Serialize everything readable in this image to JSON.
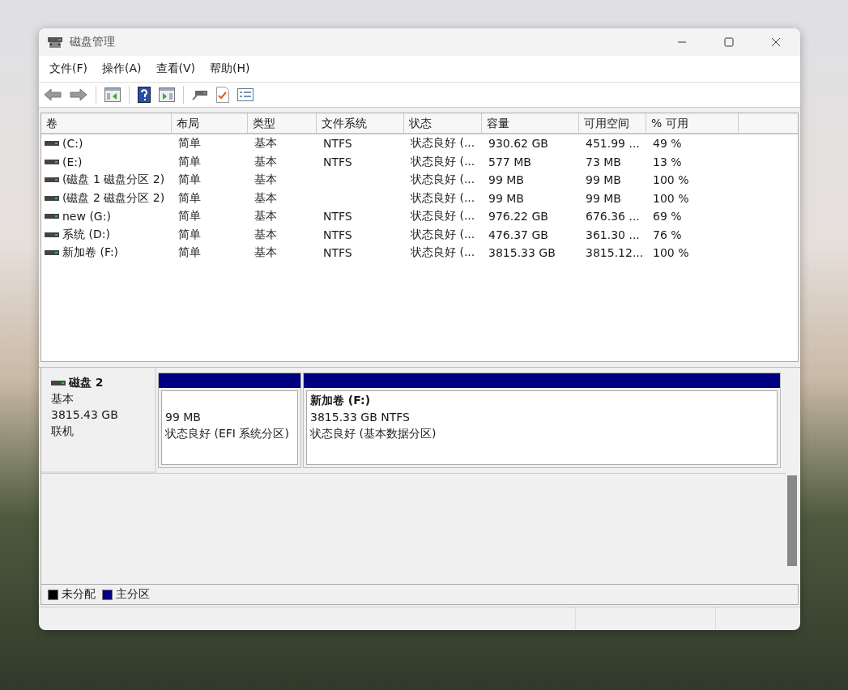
{
  "window": {
    "title": "磁盘管理"
  },
  "menu": [
    "文件(F)",
    "操作(A)",
    "查看(V)",
    "帮助(H)"
  ],
  "volume_table": {
    "columns": [
      "卷",
      "布局",
      "类型",
      "文件系统",
      "状态",
      "容量",
      "可用空间",
      "% 可用"
    ],
    "rows": [
      [
        "(C:)",
        "简单",
        "基本",
        "NTFS",
        "状态良好 (...",
        "930.62 GB",
        "451.99 ...",
        "49 %"
      ],
      [
        "(E:)",
        "简单",
        "基本",
        "NTFS",
        "状态良好 (...",
        "577 MB",
        "73 MB",
        "13 %"
      ],
      [
        "(磁盘 1 磁盘分区 2)",
        "简单",
        "基本",
        null,
        "状态良好 (...",
        "99 MB",
        "99 MB",
        "100 %"
      ],
      [
        "(磁盘 2 磁盘分区 2)",
        "简单",
        "基本",
        null,
        "状态良好 (...",
        "99 MB",
        "99 MB",
        "100 %"
      ],
      [
        "new (G:)",
        "简单",
        "基本",
        "NTFS",
        "状态良好 (...",
        "976.22 GB",
        "676.36 ...",
        "69 %"
      ],
      [
        "系统 (D:)",
        "简单",
        "基本",
        "NTFS",
        "状态良好 (...",
        "476.37 GB",
        "361.30 ...",
        "76 %"
      ],
      [
        "新加卷 (F:)",
        "简单",
        "基本",
        "NTFS",
        "状态良好 (...",
        "3815.33 GB",
        "3815.12...",
        "100 %"
      ]
    ]
  },
  "disks": [
    {
      "name": "磁盘 2",
      "type": "基本",
      "size": "3815.43 GB",
      "state": "联机",
      "partitions": [
        {
          "size": "99 MB",
          "status": "状态良好 (EFI 系统分区)",
          "color": "#000080"
        },
        {
          "name": "新加卷 (F:)",
          "size": "3815.33 GB NTFS",
          "status": "状态良好 (基本数据分区)",
          "color": "#000080"
        }
      ]
    }
  ],
  "legend": [
    {
      "label": "未分配",
      "color": "#000000"
    },
    {
      "label": "主分区",
      "color": "#000080"
    }
  ]
}
